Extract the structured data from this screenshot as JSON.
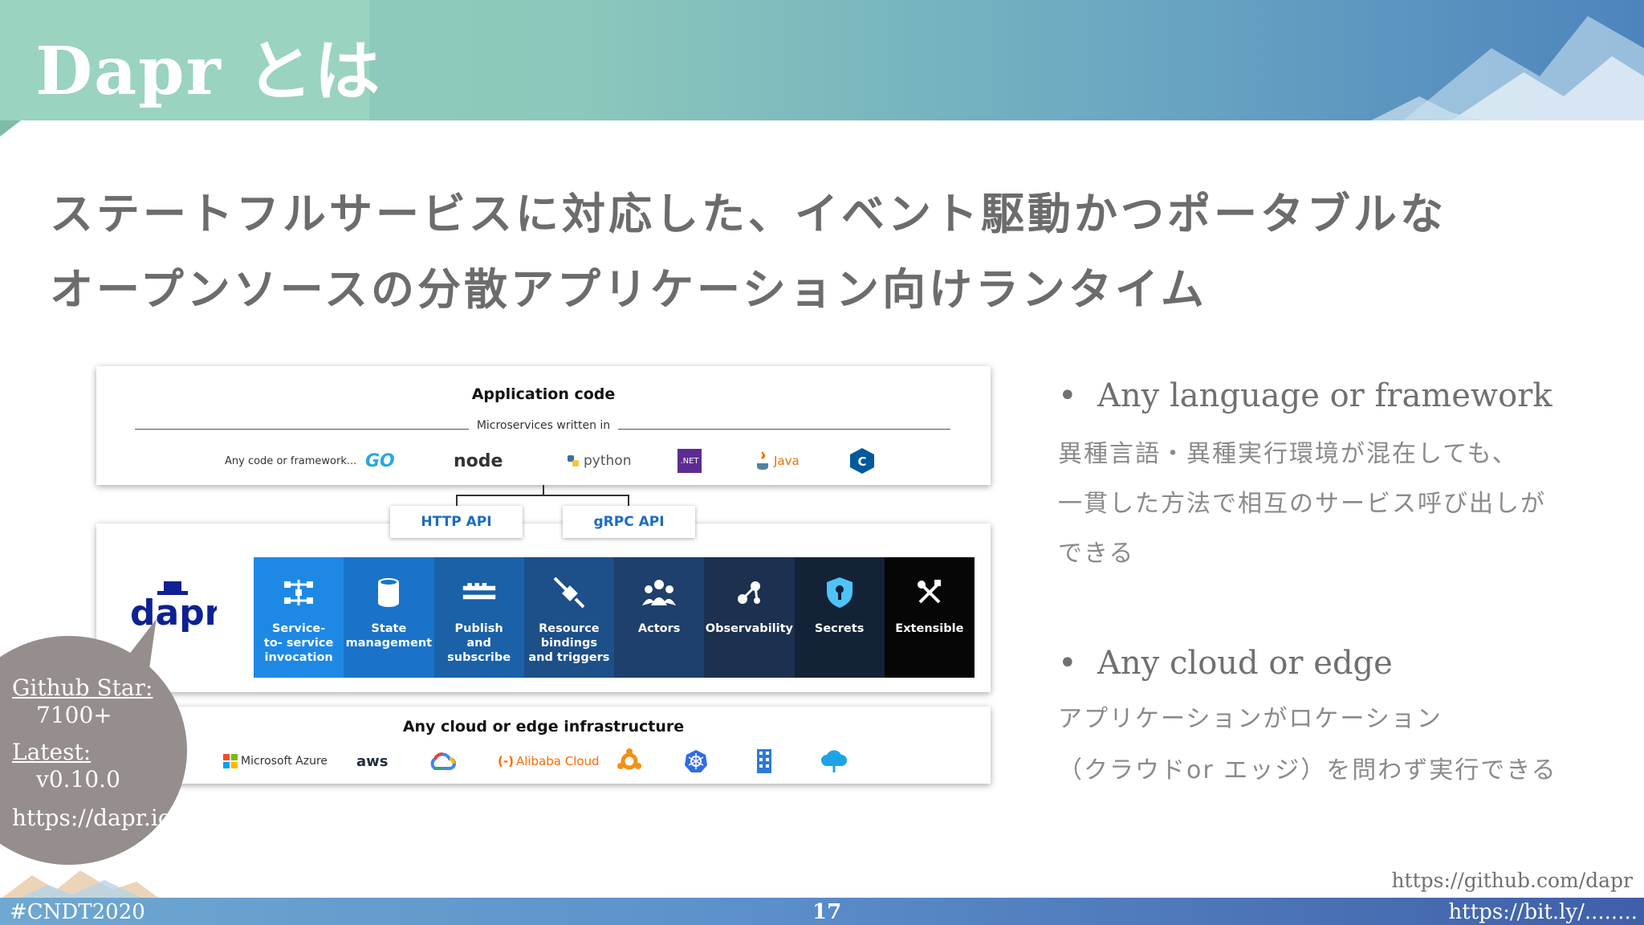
{
  "slide": {
    "title": "Dapr とは",
    "subtitle_line1": "ステートフルサービスに対応した、イベント駆動かつポータブルな",
    "subtitle_line2": "オープンソースの分散アプリケーション向けランタイム"
  },
  "diagram": {
    "app_card": {
      "title": "Application code",
      "microservices_label": "Microservices written in",
      "any_code_label": "Any code or framework...",
      "languages": [
        "GO",
        "node",
        "python",
        ".NET",
        "Java",
        "C++"
      ]
    },
    "apis": {
      "http": "HTTP API",
      "grpc": "gRPC API"
    },
    "dapr_logo_text": "dapr",
    "building_blocks": [
      {
        "label": "Service-\nto- service\ninvocation",
        "color": "#1e88e5"
      },
      {
        "label": "State\nmanagement",
        "color": "#1a73c8"
      },
      {
        "label": "Publish\nand\nsubscribe",
        "color": "#1a61a8"
      },
      {
        "label": "Resource\nbindings\nand triggers",
        "color": "#1d4f88"
      },
      {
        "label": "Actors",
        "color": "#1f3f6c"
      },
      {
        "label": "Observability",
        "color": "#1c3050"
      },
      {
        "label": "Secrets",
        "color": "#142238"
      },
      {
        "label": "Extensible",
        "color": "#060606"
      }
    ],
    "infra_card": {
      "title": "Any cloud or edge infrastructure",
      "providers": [
        "Microsoft Azure",
        "aws",
        "Alibaba Cloud"
      ]
    }
  },
  "bullets": [
    {
      "title": "Any language or framework",
      "lines": [
        "異種言語・異種実行環境が混在しても、",
        "一貫した方法で相互のサービス呼び出しが",
        "できる"
      ]
    },
    {
      "title": "Any cloud or edge",
      "lines": [
        "アプリケーションがロケーション",
        "（クラウドor エッジ）を問わず実行できる"
      ]
    }
  ],
  "bubble": {
    "star_label": "Github Star:",
    "star_value": "7100+",
    "latest_label": "Latest:",
    "latest_value": "v0.10.0",
    "url": "https://dapr.io/"
  },
  "footer": {
    "hashtag": "#CNDT2020",
    "page": "17",
    "short_url": "https://bit.ly/........",
    "github": "https://github.com/dapr"
  }
}
